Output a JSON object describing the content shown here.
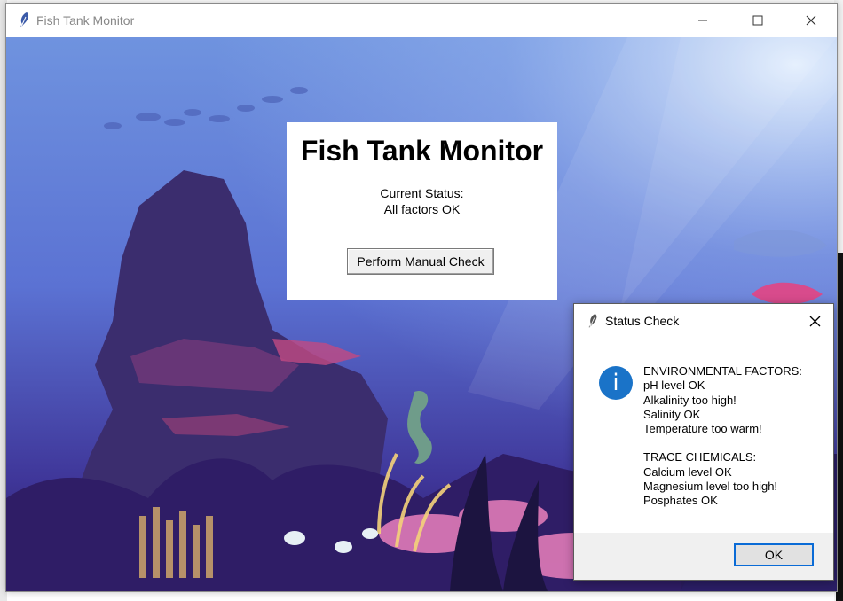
{
  "main_window": {
    "title": "Fish Tank Monitor",
    "controls": {
      "minimize": "—",
      "maximize": "☐",
      "close": "✕"
    }
  },
  "status_card": {
    "heading": "Fish Tank Monitor",
    "status_label": "Current Status:",
    "status_value": "All factors OK",
    "manual_check_label": "Perform Manual Check"
  },
  "dialog": {
    "title": "Status Check",
    "close": "✕",
    "icon": "info-icon",
    "icon_glyph": "i",
    "environmental_heading": "ENVIRONMENTAL FACTORS:",
    "environmental_items": [
      "pH level OK",
      "Alkalinity too high!",
      "Salinity OK",
      "Temperature too warm!"
    ],
    "trace_heading": "TRACE CHEMICALS:",
    "trace_items": [
      "Calcium level OK",
      "Magnesium level too high!",
      "Posphates OK"
    ],
    "ok_label": "OK"
  },
  "colors": {
    "accent": "#0a6bd6",
    "info_icon": "#1a73c8",
    "scene_top": "#7fa6e8",
    "scene_bottom": "#2a1b5c"
  }
}
